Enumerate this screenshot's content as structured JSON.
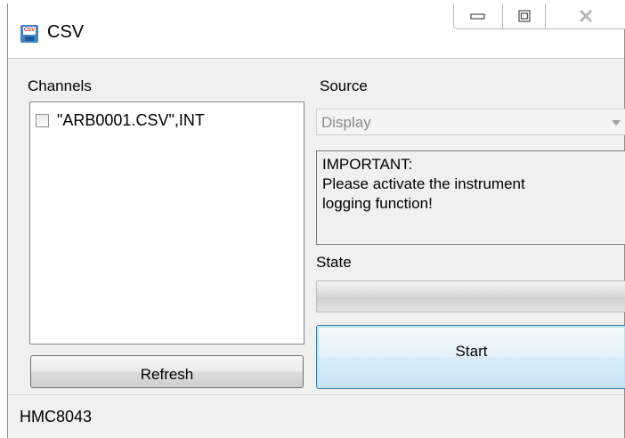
{
  "window": {
    "title": "CSV",
    "icon": "csv-save-icon",
    "controls": [
      "minimize-icon",
      "maximize-icon",
      "close-icon"
    ]
  },
  "channels": {
    "label": "Channels",
    "items": [
      {
        "label": "\"ARB0001.CSV\",INT",
        "checked": false
      }
    ],
    "refresh_label": "Refresh"
  },
  "source": {
    "label": "Source",
    "selected": "Display"
  },
  "info": {
    "line1": "IMPORTANT:",
    "line2": "Please activate the instrument",
    "line3": "logging function!"
  },
  "state": {
    "label": "State",
    "progress": 0
  },
  "start_label": "Start",
  "status_bar": {
    "text": "HMC8043"
  },
  "colors": {
    "start_border": "#3c7fb1",
    "start_glow": "#bfe3f6",
    "icon_blue": "#3f86c6"
  }
}
